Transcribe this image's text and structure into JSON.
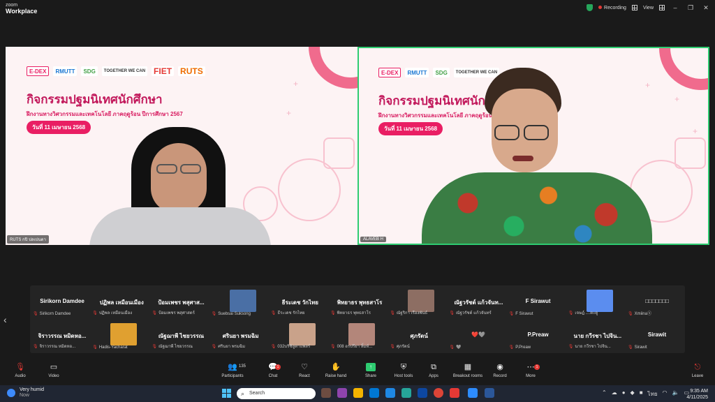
{
  "app": {
    "brand_top": "zoom",
    "brand_bottom": "Workplace",
    "recording_label": "Recording",
    "view_label": "View"
  },
  "slide": {
    "logos": [
      "E-DEX",
      "RMUTT",
      "SDG",
      "TOGETHER WE CAN",
      "FIET",
      "RUTS"
    ],
    "title": "กิจกรรมปฐมนิเทศนักศึกษา",
    "subtitle": "ฝึกงานทางวิศวกรรมและเทคโนโลยี ภาคฤดูร้อน ปีการศึกษา 2567",
    "date": "วันที่ 11 เมษายน 2568"
  },
  "tiles": [
    {
      "name": "RUTS กปิ ปลเปนตา"
    },
    {
      "name": "ALAVEB H"
    }
  ],
  "participants": [
    {
      "big": "Sirikorn Damdee",
      "small": "Sirikorn Damdee"
    },
    {
      "big": "ปฏิพล เหมือนเมือง",
      "small": "ปฏิพล เหมือนเมือง"
    },
    {
      "big": "ป้อมเพชร พสุศาส...",
      "small": "ป้อมเพชร พสุศาสตร์"
    },
    {
      "big": "",
      "small": "Suebsai Suksong",
      "thumb": "#4a6fa5"
    },
    {
      "big": "ธีระเดช วักไทย",
      "small": "ธีระเดช รักไทย"
    },
    {
      "big": "พิทยาธร พุทธสาโร",
      "small": "พิทยาธร พุทธสาโร"
    },
    {
      "big": "",
      "small": "ณัฐริกา เรืองพันธ์",
      "thumb": "#8d6e63"
    },
    {
      "big": "ณัฐวรัชต์ แก้วจันท...",
      "small": "ณัฐวรัชต์ แก้วจันทร์"
    },
    {
      "big": "F Sirawut",
      "small": "F Sirawut"
    },
    {
      "big": "",
      "small": "เจษฎ์ ....ตะดู",
      "thumb": "#5b8def"
    },
    {
      "big": "□□□□□□□",
      "small": "Xmiinaⓢ"
    },
    {
      "big": "จิราวรรณ หมิดหอ...",
      "small": "จิราวรรณ หมิดหอ..."
    },
    {
      "big": "",
      "small": "Hadis-Yacharat",
      "thumb": "#e0a030"
    },
    {
      "big": "ณัฐฌาพี ไชยวรรณ",
      "small": "ณัฐฌาพี ไชยวรรณ"
    },
    {
      "big": "ศรินยา พรมฉิม",
      "small": "ศรินยา พรมฉิม"
    },
    {
      "big": "",
      "small": "032บริซิลูตาแพลร์",
      "thumb": "#c9a28a"
    },
    {
      "big": "",
      "small": "008 อรปรียา ลิ้มห์...",
      "thumb": "#b3867a"
    },
    {
      "big": "ศุภรัตน์",
      "small": "ศุภรัตน์"
    },
    {
      "big": "❤️🩶",
      "small": "🩶"
    },
    {
      "big": "P.Preaw",
      "small": "P.Preaw"
    },
    {
      "big": "นาย กวีรชา ไปจิน...",
      "small": "นาย กวีรชา ไปจิน..."
    },
    {
      "big": "Sirawit",
      "small": "Sirawit"
    }
  ],
  "toolbar": {
    "audio": "Audio",
    "video": "Video",
    "participants": "Participants",
    "participants_count": "135",
    "chat": "Chat",
    "chat_badge": "1",
    "react": "React",
    "raise_hand": "Raise hand",
    "share": "Share",
    "host_tools": "Host tools",
    "apps": "Apps",
    "breakout": "Breakout rooms",
    "record": "Record",
    "more": "More",
    "more_badge": "1",
    "leave": "Leave"
  },
  "taskbar": {
    "weather_line1": "Very humid",
    "weather_line2": "Now",
    "weather_badge": "4",
    "search": "Search",
    "time": "9:35 AM",
    "date": "4/11/2025",
    "lang": "ไทย"
  }
}
